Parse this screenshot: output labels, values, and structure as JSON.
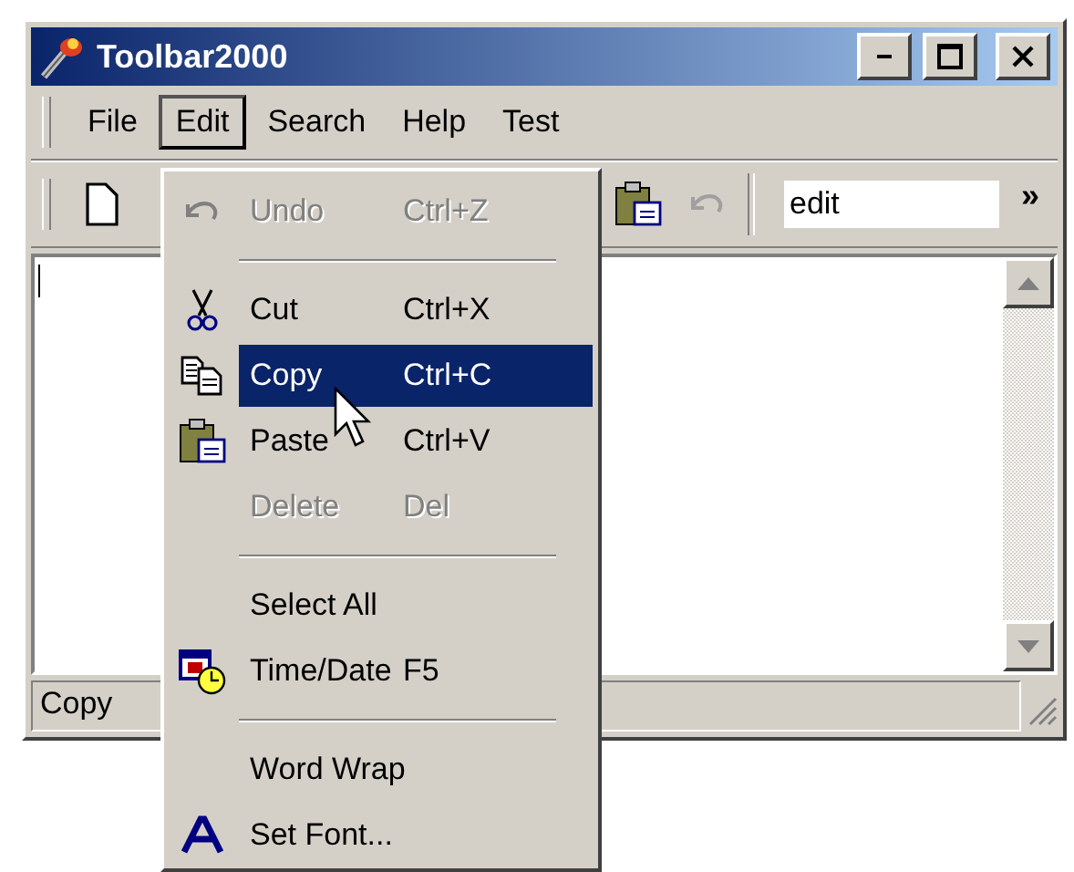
{
  "window": {
    "title": "Toolbar2000"
  },
  "menu_bar": [
    {
      "label": "File",
      "selected": false
    },
    {
      "label": "Edit",
      "selected": true
    },
    {
      "label": "Search",
      "selected": false
    },
    {
      "label": "Help",
      "selected": false
    },
    {
      "label": "Test",
      "selected": false
    }
  ],
  "toolbar": {
    "field_value": "edit",
    "more": "»"
  },
  "status_bar": {
    "text": "Copy"
  },
  "edit_menu": [
    {
      "kind": "item",
      "label": "Undo",
      "shortcut": "Ctrl+Z",
      "disabled": true,
      "selected": false
    },
    {
      "kind": "separator"
    },
    {
      "kind": "item",
      "label": "Cut",
      "shortcut": "Ctrl+X",
      "disabled": false,
      "selected": false
    },
    {
      "kind": "item",
      "label": "Copy",
      "shortcut": "Ctrl+C",
      "disabled": false,
      "selected": true
    },
    {
      "kind": "item",
      "label": "Paste",
      "shortcut": "Ctrl+V",
      "disabled": false,
      "selected": false
    },
    {
      "kind": "item",
      "label": "Delete",
      "shortcut": "Del",
      "disabled": true,
      "selected": false
    },
    {
      "kind": "separator"
    },
    {
      "kind": "item",
      "label": "Select All",
      "disabled": false,
      "selected": false
    },
    {
      "kind": "item",
      "label": "Time/Date",
      "shortcut": "F5",
      "disabled": false,
      "selected": false
    },
    {
      "kind": "separator"
    },
    {
      "kind": "item",
      "label": "Word Wrap",
      "disabled": false,
      "selected": false
    },
    {
      "kind": "item",
      "label": "Set Font...",
      "disabled": false,
      "selected": false
    }
  ]
}
